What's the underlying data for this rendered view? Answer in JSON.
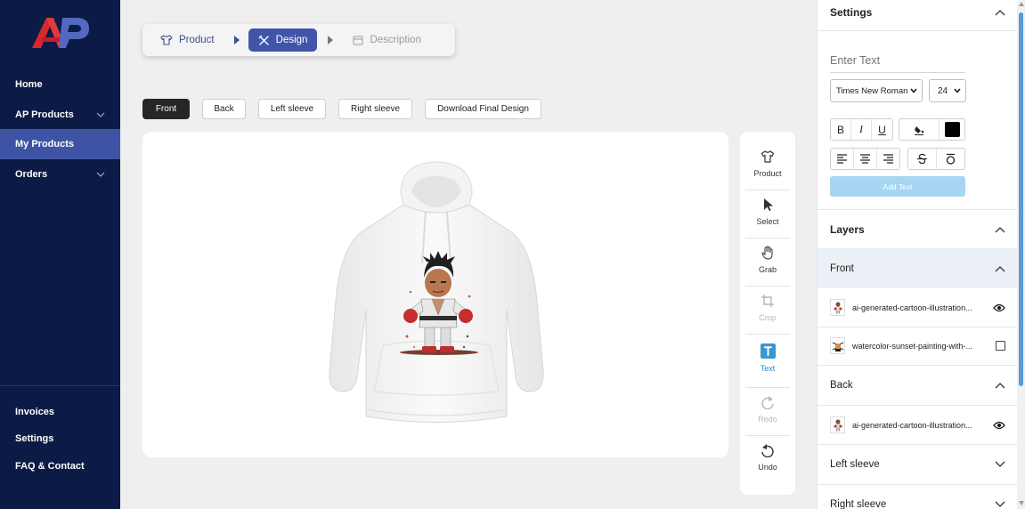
{
  "sidebar": {
    "items": [
      {
        "label": "Home"
      },
      {
        "label": "AP Products"
      },
      {
        "label": "My Products"
      },
      {
        "label": "Orders"
      }
    ],
    "bottom_items": [
      {
        "label": "Invoices"
      },
      {
        "label": "Settings"
      },
      {
        "label": "FAQ & Contact"
      }
    ],
    "active_item": "My Products",
    "colors": {
      "background": "#0c1b45",
      "active": "#3f53a4"
    }
  },
  "stepper": {
    "steps": [
      {
        "label": "Product",
        "icon": "tshirt-icon"
      },
      {
        "label": "Design",
        "icon": "design-tools-icon"
      },
      {
        "label": "Description",
        "icon": "card-icon"
      }
    ],
    "active": "Design"
  },
  "views": {
    "buttons": [
      {
        "label": "Front"
      },
      {
        "label": "Back"
      },
      {
        "label": "Left sleeve"
      },
      {
        "label": "Right sleeve"
      },
      {
        "label": "Download Final Design"
      }
    ],
    "active": "Front"
  },
  "tools": [
    {
      "label": "Product",
      "icon": "tshirt-icon"
    },
    {
      "label": "Select",
      "icon": "cursor-icon"
    },
    {
      "label": "Grab",
      "icon": "hand-icon"
    },
    {
      "label": "Crop",
      "icon": "crop-icon"
    },
    {
      "label": "Text",
      "icon": "text-icon"
    },
    {
      "label": "Redo",
      "icon": "redo-icon"
    },
    {
      "label": "Undo",
      "icon": "undo-icon"
    }
  ],
  "settings": {
    "title": "Settings",
    "text_placeholder": "Enter Text",
    "font_family": "Times New Roman",
    "font_size": "24",
    "bold": "B",
    "italic": "I",
    "underline": "U",
    "text_color": "#000000",
    "add_text_label": "Add Text"
  },
  "layers": {
    "title": "Layers",
    "groups": [
      {
        "name": "Front",
        "items": [
          {
            "name": "ai-generated-cartoon-illustration...",
            "visible": true
          },
          {
            "name": "watercolor-sunset-painting-with-...",
            "visible": false
          }
        ]
      },
      {
        "name": "Back",
        "items": [
          {
            "name": "ai-generated-cartoon-illustration...",
            "visible": true
          }
        ]
      },
      {
        "name": "Left sleeve",
        "items": []
      },
      {
        "name": "Right sleeve",
        "items": []
      }
    ]
  }
}
